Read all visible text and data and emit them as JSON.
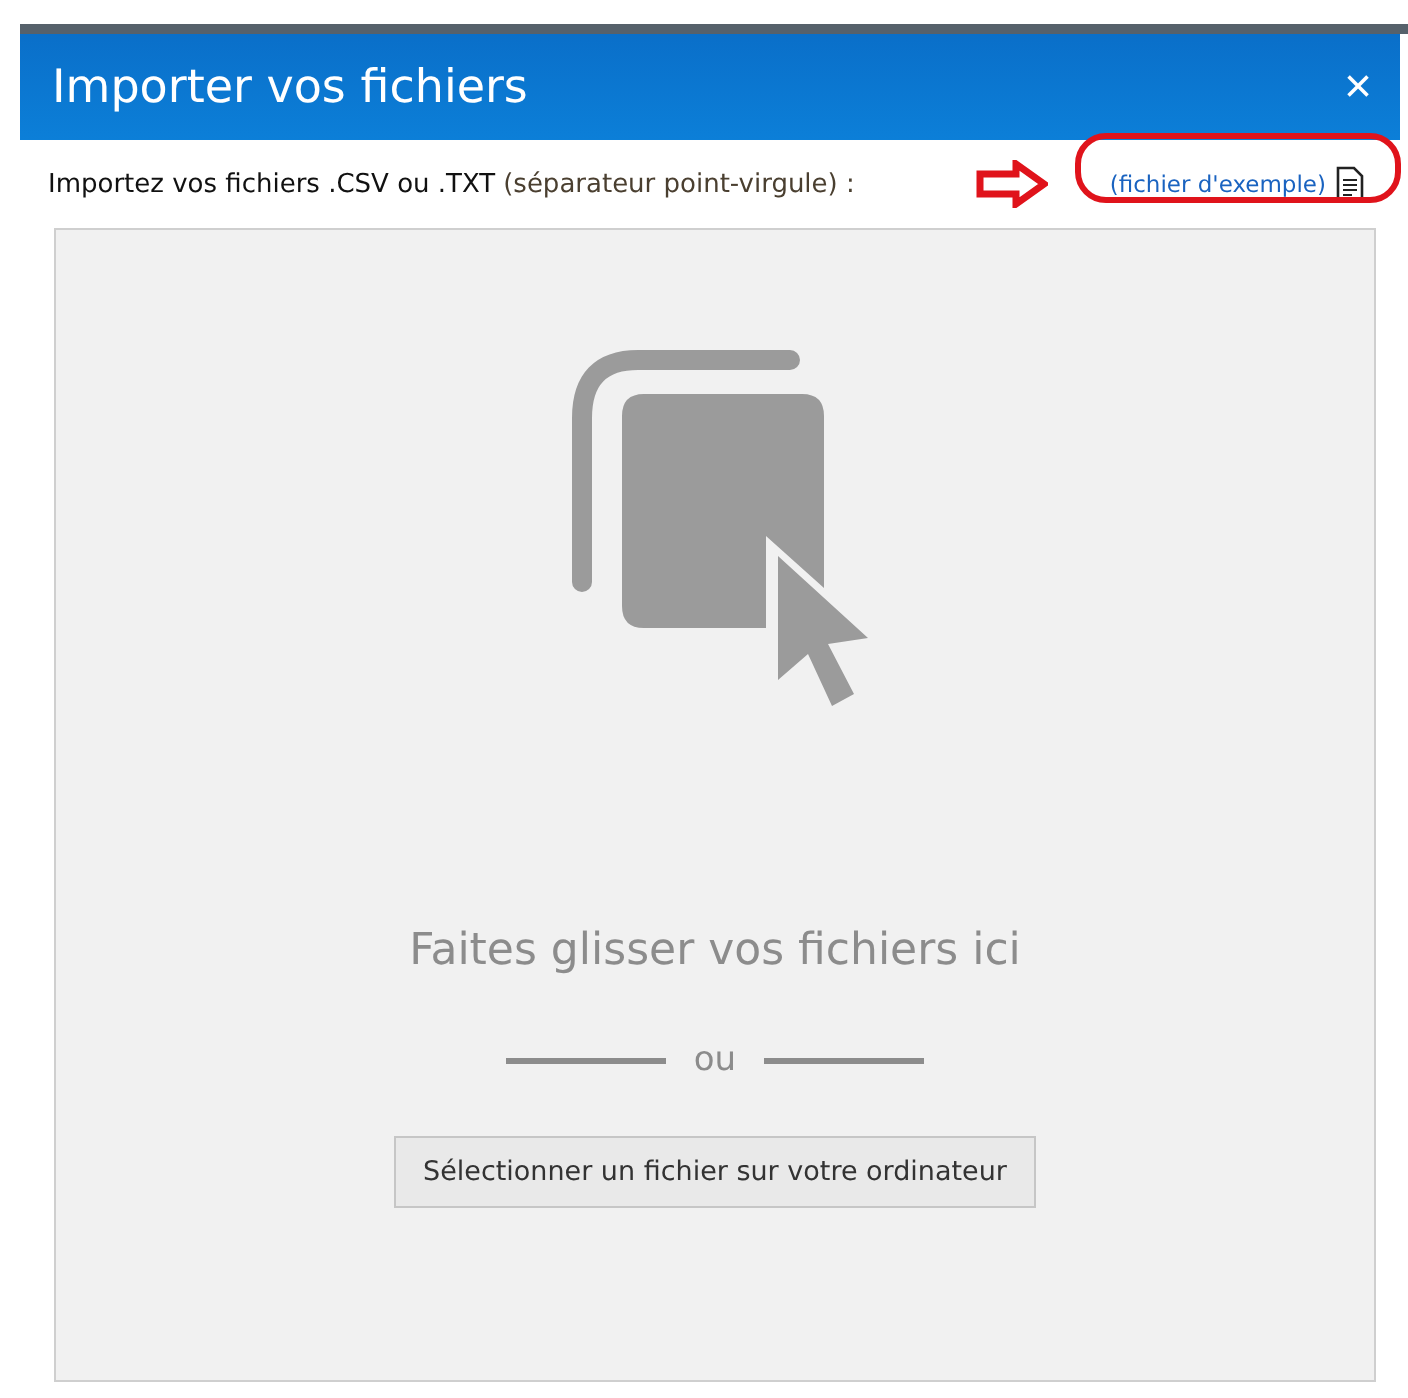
{
  "dialog": {
    "title": "Importer vos fichiers",
    "close": "×"
  },
  "instruction": {
    "label": "Importez vos fichiers .CSV ou .TXT",
    "hint": "(séparateur point-virgule) :",
    "link": "(fichier d'exemple)"
  },
  "dropzone": {
    "message": "Faites glisser vos fichiers ici",
    "separator": "ou",
    "button": "Sélectionner un fichier sur votre ordinateur"
  }
}
